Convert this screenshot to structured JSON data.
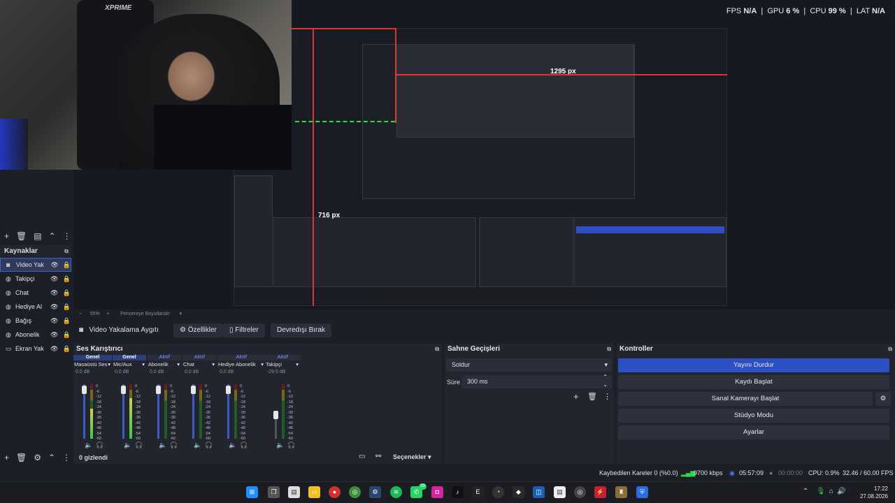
{
  "stats": {
    "fps_label": "FPS",
    "fps_value": "N/A",
    "gpu_label": "GPU",
    "gpu_value": "6 %",
    "cpu_label": "CPU",
    "cpu_value": "99 %",
    "lat_label": "LAT",
    "lat_value": "N/A"
  },
  "webcam": {
    "chair_brand": "XPRIME"
  },
  "preview": {
    "measure_h": "1295 px",
    "measure_v": "716 px",
    "zoom": "55%",
    "fit_label": "Pencereye Boyutlandır"
  },
  "sources": {
    "title": "Kaynaklar",
    "items": [
      {
        "label": "Video Yak",
        "icon": "camera-icon",
        "selected": true
      },
      {
        "label": "Takipçi",
        "icon": "globe-icon"
      },
      {
        "label": "Chat",
        "icon": "globe-icon"
      },
      {
        "label": "Hediye Al",
        "icon": "globe-icon"
      },
      {
        "label": "Bağış",
        "icon": "globe-icon"
      },
      {
        "label": "Abonelik",
        "icon": "globe-icon"
      },
      {
        "label": "Ekran Yak",
        "icon": "monitor-icon"
      }
    ]
  },
  "source_bar": {
    "name": "Video Yakalama Aygıtı",
    "properties": "Özellikler",
    "filters": "Filtreler",
    "deactivate": "Devredışı Bırak"
  },
  "mixer": {
    "title": "Ses Karıştırıcı",
    "channels": [
      {
        "status": "Genel",
        "name": "Masaüstü Ses",
        "db": "0.0 dB",
        "level": 0.55
      },
      {
        "status": "Genel",
        "name": "Mic/Aux",
        "db": "0.0 dB",
        "level": 0.75
      },
      {
        "status": "Aktif",
        "name": "Abonelik",
        "db": "0.0 dB",
        "level": 0
      },
      {
        "status": "Aktif",
        "name": "Chat",
        "db": "0.0 dB",
        "level": 0
      },
      {
        "status": "Aktif",
        "name": "Hediye Abonelik",
        "db": "0.0 dB",
        "level": 0
      },
      {
        "status": "Aktif",
        "name": "Takipçi",
        "db": "-29.5 dB",
        "level": 0
      }
    ],
    "scale": [
      "0",
      "-6",
      "-12",
      "-18",
      "-24",
      "-30",
      "-36",
      "-42",
      "-48",
      "-54",
      "-60"
    ],
    "hidden": "0 gizlendi",
    "options": "Seçenekler"
  },
  "transitions": {
    "title": "Sahne Geçişleri",
    "selected": "Soldur",
    "duration_label": "Süre",
    "duration_value": "300 ms"
  },
  "controls": {
    "title": "Kontroller",
    "stop_stream": "Yayını Durdur",
    "start_record": "Kaydı Başlat",
    "virtual_cam": "Sanal Kamerayı Başlat",
    "studio_mode": "Stüdyo Modu",
    "settings": "Ayarlar"
  },
  "status": {
    "dropped": "Kaybedilen Kareler 0 (%0.0)",
    "bitrate": "9700 kbps",
    "stream_time": "05:57:09",
    "rec_time": "00:00:00",
    "cpu": "CPU: 0.9%",
    "fps": "32.46 / 60.00 FPS"
  },
  "taskbar": {
    "time": "17:22",
    "date": "27.08.2026",
    "whatsapp_badge": "29"
  },
  "colors": {
    "accent": "#2d4fc4",
    "panel": "#22252d",
    "background": "#1d1f26",
    "measure": "#e23232"
  }
}
